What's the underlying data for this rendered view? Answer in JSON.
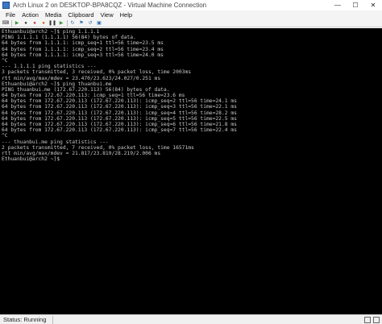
{
  "window": {
    "title": "Arch Linux 2 on DESKTOP-BPA8CQZ - Virtual Machine Connection",
    "minimize": "—",
    "maximize": "☐",
    "close": "✕"
  },
  "menu": [
    "File",
    "Action",
    "Media",
    "Clipboard",
    "View",
    "Help"
  ],
  "toolbar": {
    "buttons": [
      {
        "name": "ctrl-alt-del-button",
        "glyph": "⌨",
        "color": "#333333"
      },
      {
        "name": "start-button",
        "glyph": "▶",
        "color": "#3a9a3a"
      },
      {
        "name": "turn-off-button",
        "glyph": "●",
        "color": "#333333"
      },
      {
        "name": "shutdown-button",
        "glyph": "●",
        "color": "#c03030"
      },
      {
        "name": "save-button",
        "glyph": "●",
        "color": "#d06020"
      },
      {
        "name": "pause-button",
        "glyph": "❚❚",
        "color": "#333333"
      },
      {
        "name": "resume-button",
        "glyph": "▶",
        "color": "#3a9a3a"
      },
      {
        "name": "reset-button",
        "glyph": "↻",
        "color": "#2a6ab0"
      },
      {
        "name": "checkpoint-button",
        "glyph": "⚑",
        "color": "#2a6ab0"
      },
      {
        "name": "revert-button",
        "glyph": "↺",
        "color": "#2a6ab0"
      },
      {
        "name": "enhanced-session-button",
        "glyph": "▣",
        "color": "#2a6ab0"
      }
    ]
  },
  "terminal": {
    "lines": [
      "Ethuanbui@arch2 ~]$ ping 1.1.1.1",
      "PING 1.1.1.1 (1.1.1.1) 56(84) bytes of data.",
      "64 bytes from 1.1.1.1: icmp_seq=1 ttl=56 time=23.5 ms",
      "64 bytes from 1.1.1.1: icmp_seq=2 ttl=56 time=23.4 ms",
      "64 bytes from 1.1.1.1: icmp_seq=3 ttl=56 time=24.0 ms",
      "^C",
      "--- 1.1.1.1 ping statistics ---",
      "3 packets transmitted, 3 received, 0% packet loss, time 2003ms",
      "rtt min/avg/max/mdev = 23.470/23.623/24.027/0.251 ms",
      "Ethuanbui@arch2 ~]$ ping thuanbui.me",
      "PING thuanbui.me (172.67.220.113) 56(84) bytes of data.",
      "64 bytes from 172.67.220.113: icmp_seq=1 ttl=56 time=23.6 ms",
      "64 bytes from 172.67.220.113 (172.67.220.113): icmp_seq=2 ttl=56 time=24.1 ms",
      "64 bytes from 172.67.220.113 (172.67.220.113): icmp_seq=3 ttl=56 time=22.1 ms",
      "64 bytes from 172.67.220.113 (172.67.220.113): icmp_seq=4 ttl=56 time=28.2 ms",
      "64 bytes from 172.67.220.113 (172.67.220.113): icmp_seq=5 ttl=56 time=22.5 ms",
      "64 bytes from 172.67.220.113 (172.67.220.113): icmp_seq=6 ttl=56 time=21.8 ms",
      "64 bytes from 172.67.220.113 (172.67.220.113): icmp_seq=7 ttl=56 time=22.4 ms",
      "^C",
      "--- thuanbui.me ping statistics ---",
      "2 packets transmitted, 7 received, 0% packet loss, time 16571ms",
      "rtt min/avg/max/mdev = 21.817/23.819/28.219/2.006 ms",
      "Ethuanbui@arch2 ~]$"
    ]
  },
  "status": {
    "text": "Status: Running"
  }
}
